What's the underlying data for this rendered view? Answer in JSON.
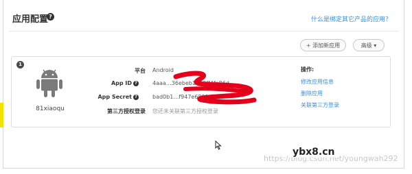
{
  "header": {
    "title": "应用配置",
    "help_link": "什么是绑定其它产品的应用？"
  },
  "toolbar": {
    "add_app": "+ 添加新应用",
    "advanced": "高级 ▾"
  },
  "app_card": {
    "index": "1",
    "platform_icon": "android-icon",
    "app_name": "81xiaoqu",
    "rows": [
      {
        "label": "平台",
        "value": "Android"
      },
      {
        "label": "App ID",
        "value": "4aaa…36ebeb1650ff4fa86d"
      },
      {
        "label": "App Secret",
        "value": "bad0b1…f947e689f…"
      },
      {
        "label": "第三方授权登录",
        "value": "您还未关联第三方授权登录"
      }
    ],
    "actions_title": "操作:",
    "actions": [
      "修改应用信息",
      "删除应用",
      "关联第三方登录"
    ]
  },
  "overlay": {
    "watermark": "https://blog.csdn.net/youngwah292",
    "site_logo": "ybx8.cn"
  },
  "colors": {
    "link": "#3a8fd8",
    "redaction": "#e3001b",
    "marker": "#f2e200"
  }
}
